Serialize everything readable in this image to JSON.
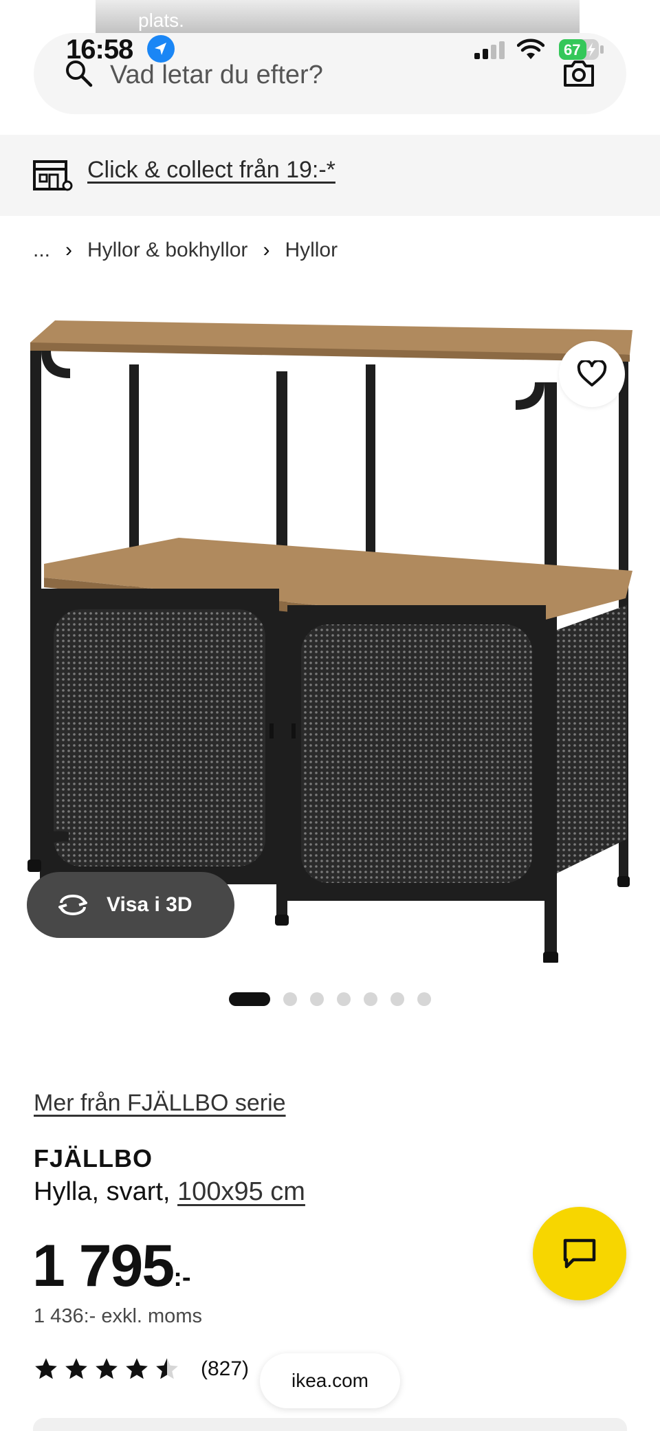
{
  "notification": {
    "text": "plats."
  },
  "status_bar": {
    "time": "16:58",
    "battery": "67",
    "location_icon": "location-arrow-icon",
    "signal_icon": "cellular-signal-icon",
    "wifi_icon": "wifi-icon"
  },
  "search": {
    "placeholder": "Vad letar du efter?",
    "icon": "search-icon",
    "camera_icon": "camera-icon"
  },
  "collect": {
    "label": "Click & collect från 19:-*",
    "icon": "store-icon"
  },
  "breadcrumb": {
    "items": [
      "...",
      "Hyllor & bokhyllor",
      "Hyllor"
    ]
  },
  "gallery": {
    "view3d_label": "Visa i 3D",
    "dot_count": 7,
    "active_index": 0
  },
  "product": {
    "series_link": "Mer från FJÄLLBO serie",
    "name": "FJÄLLBO",
    "description": "Hylla, svart, ",
    "size_link": "100x95 cm",
    "price": "1 795",
    "price_suffix": ":-",
    "price_excl": "1 436:- exkl. moms",
    "rating": 4.5,
    "rating_max": 5,
    "review_count": "(827)"
  },
  "browser": {
    "url": "ikea.com"
  },
  "colors": {
    "chat_yellow": "#f7d600",
    "dark_button": "#484848",
    "band_gray": "#f5f5f5",
    "wood": "#b08a5e"
  }
}
